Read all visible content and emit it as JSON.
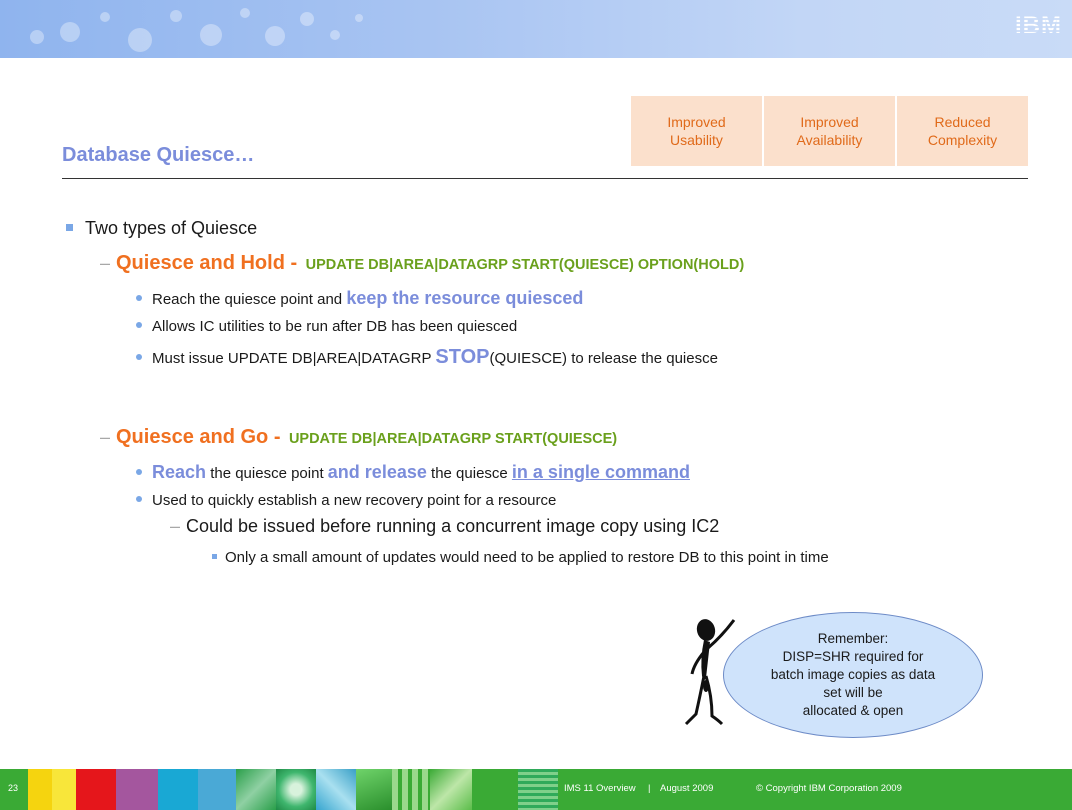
{
  "header": {
    "logo_text": "IBM"
  },
  "title": "Database Quiesce…",
  "categories": [
    "Improved Usability",
    "Improved Availability",
    "Reduced Complexity"
  ],
  "content": {
    "l1": "Two types of Quiesce",
    "hold": {
      "heading": "Quiesce and Hold -",
      "command": "UPDATE DB|AREA|DATAGRP START(QUIESCE) OPTION(HOLD)",
      "b1_pre": "Reach the quiesce point and ",
      "b1_emph": "keep the resource quiesced",
      "b2": "Allows IC utilities to be run after DB has been quiesced",
      "b3_pre": "Must issue UPDATE DB|AREA|DATAGRP ",
      "b3_emph": "STOP",
      "b3_post": "(QUIESCE) to release the quiesce"
    },
    "go": {
      "heading": "Quiesce and Go -",
      "command": "UPDATE DB|AREA|DATAGRP START(QUIESCE)",
      "b1_w1": "Reach",
      "b1_t1": " the quiesce point ",
      "b1_w2": "and release",
      "b1_t2": " the quiesce ",
      "b1_w3": "in a single command",
      "b2": "Used to quickly establish a new recovery point for a resource",
      "sub": "Could be issued before running a concurrent image copy using IC2",
      "subsub": "Only a small amount of updates would need to be applied to restore DB to this point in time"
    }
  },
  "callout": {
    "line1": "Remember:",
    "line2": "DISP=SHR required for",
    "line3": "batch image copies as data",
    "line4": "set will be",
    "line5": "allocated & open"
  },
  "footer": {
    "slide_number": "23",
    "product": "IMS 11 Overview",
    "separator": "|",
    "date": "August 2009",
    "copyright": "© Copyright IBM Corporation 2009"
  }
}
